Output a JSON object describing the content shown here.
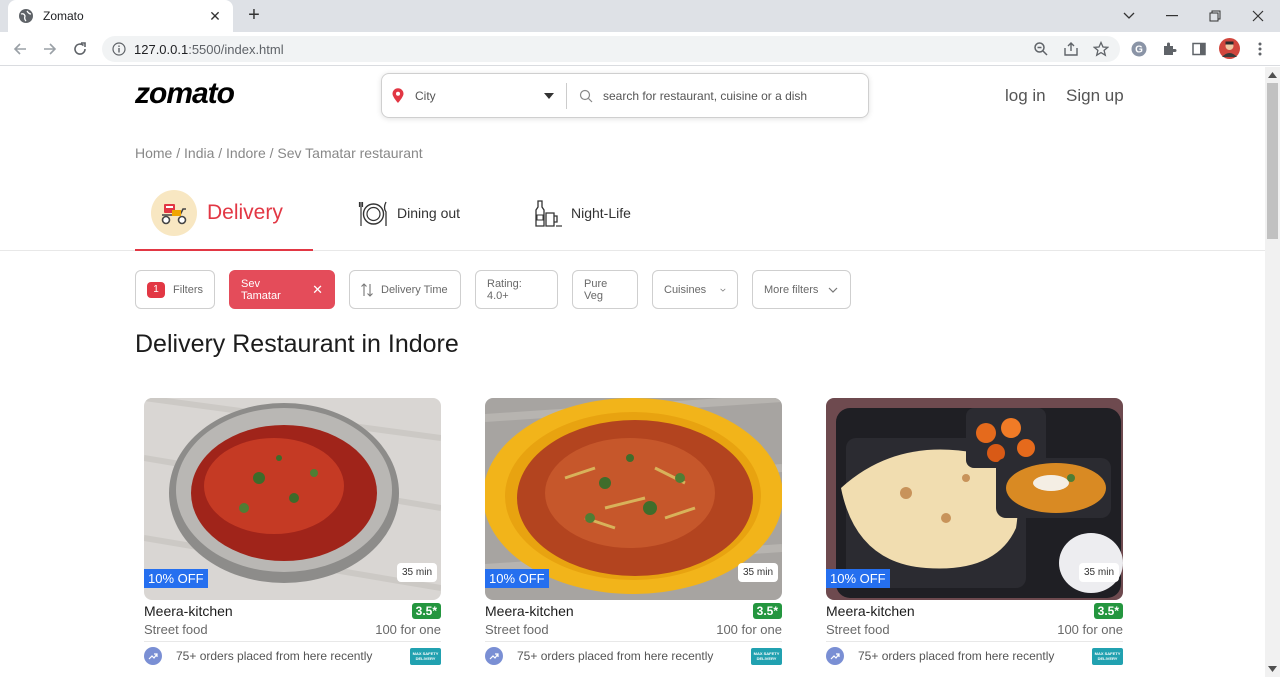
{
  "browser": {
    "tab_title": "Zomato",
    "url_host": "127.0.0.1",
    "url_rest": ":5500/index.html"
  },
  "header": {
    "logo": "zomato",
    "city_label": "City",
    "search_placeholder": "search for restaurant, cuisine or a dish",
    "login": "log in",
    "signup": "Sign up"
  },
  "breadcrumb": "Home / India / Indore / Sev Tamatar restaurant",
  "tabs": [
    {
      "label": "Delivery"
    },
    {
      "label": "Dining out"
    },
    {
      "label": "Night-Life"
    }
  ],
  "filters": {
    "count": "1",
    "filters_label": "Filters",
    "active_label": "Sev Tamatar",
    "delivery_time": "Delivery Time",
    "rating": "Rating: 4.0+",
    "pure_veg": "Pure Veg",
    "cuisines": "Cuisines",
    "more": "More filters"
  },
  "heading": "Delivery Restaurant in Indore",
  "cards": [
    {
      "offer": "10% OFF",
      "eta": "35 min",
      "name": "Meera-kitchen",
      "rating": "3.5*",
      "cuisine": "Street food",
      "price": "100 for one",
      "orders": "75+ orders placed from here recently"
    },
    {
      "offer": "10% OFF",
      "eta": "35 min",
      "name": "Meera-kitchen",
      "rating": "3.5*",
      "cuisine": "Street food",
      "price": "100 for one",
      "orders": "75+ orders placed from here recently"
    },
    {
      "offer": "10% OFF",
      "eta": "35 min",
      "name": "Meera-kitchen",
      "rating": "3.5*",
      "cuisine": "Street food",
      "price": "100 for one",
      "orders": "75+ orders placed from here recently"
    }
  ],
  "safety_badge": {
    "line1": "MAX SAFETY",
    "line2": "DELIVERY"
  },
  "colors": {
    "brand": "#e23744",
    "rating": "#24963f",
    "offer": "#256fef"
  }
}
